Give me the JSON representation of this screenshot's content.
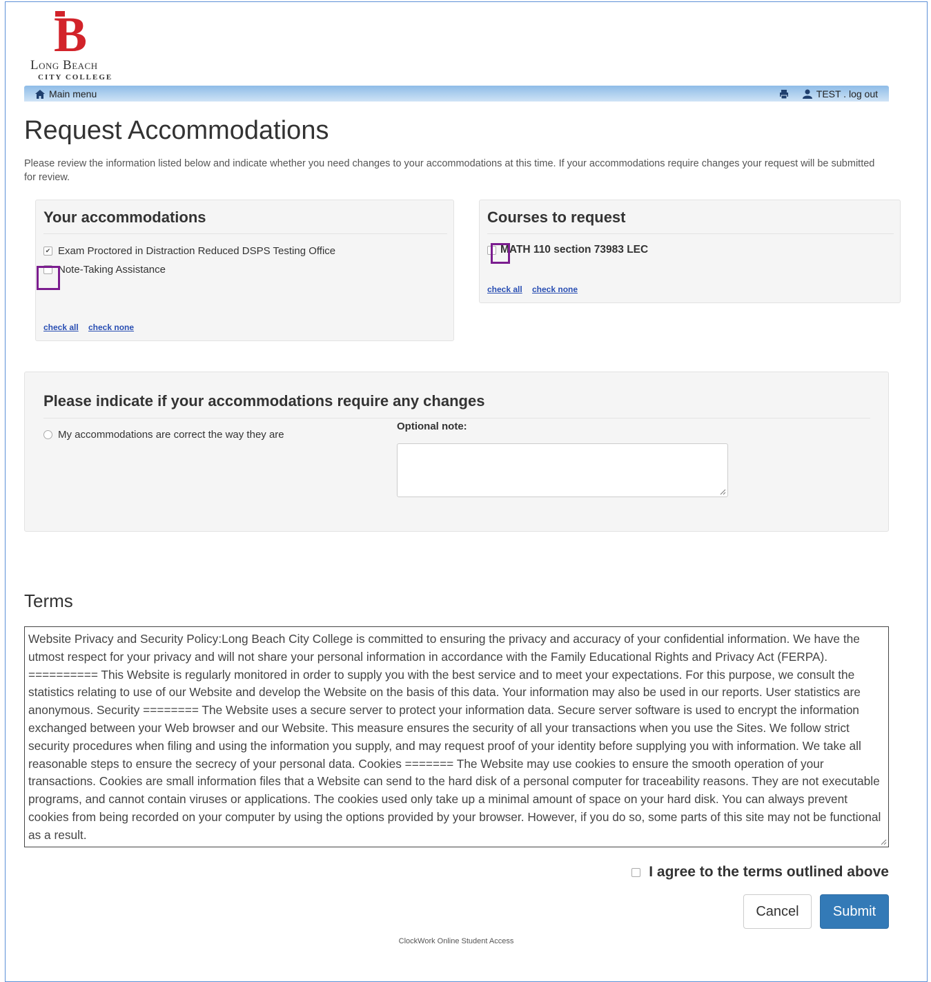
{
  "brand": {
    "name": "Long Beach",
    "subtitle": "CITY COLLEGE"
  },
  "nav": {
    "home_label": "Main menu",
    "user_label": "TEST . log out"
  },
  "page": {
    "title": "Request Accommodations",
    "intro": "Please review the information listed below and indicate whether you need changes to your accommodations at this time. If your accommodations require changes your request will be submitted for review."
  },
  "accommodations": {
    "title": "Your accommodations",
    "items": [
      {
        "label": "Exam Proctored in Distraction Reduced DSPS Testing Office",
        "checked": true
      },
      {
        "label": "Note-Taking Assistance",
        "checked": false
      }
    ],
    "check_all": "check all",
    "check_none": "check none"
  },
  "courses": {
    "title": "Courses to request",
    "items": [
      {
        "label": "MATH 110 section 73983 LEC",
        "checked": false
      }
    ],
    "check_all": "check all",
    "check_none": "check none"
  },
  "changes": {
    "title": "Please indicate if your accommodations require any changes",
    "option_label": "My accommodations are correct the way they are",
    "note_label": "Optional note:",
    "note_value": ""
  },
  "terms": {
    "title": "Terms",
    "text": "Website Privacy and Security Policy:Long Beach City College is committed to ensuring the privacy and accuracy of your confidential information. We have the utmost respect for your privacy and will not share your personal information in accordance with the Family Educational Rights and Privacy Act (FERPA). ========== This Website is regularly monitored in order to supply you with the best service and to meet your expectations. For this purpose, we consult the statistics relating to use of our Website and develop the Website on the basis of this data. Your information may also be used in our reports. User statistics are anonymous. Security ======== The Website uses a secure server to protect your information data. Secure server software is used to encrypt the information exchanged between your Web browser and our Website. This measure ensures the security of all your transactions when you use the Sites. We follow strict security procedures when filing and using the information you supply, and may request proof of your identity before supplying you with information. We take all reasonable steps to ensure the secrecy of your personal data. Cookies ======= The Website may use cookies to ensure the smooth operation of your transactions. Cookies are small information files that a Website can send to the hard disk of a personal computer for traceability reasons. They are not executable programs, and cannot contain viruses or applications. The cookies used only take up a minimal amount of space on your hard disk. You can always prevent cookies from being recorded on your computer by using the options provided by your browser. However, if you do so, some parts of this site may not be functional as a result.",
    "agree_label": "I agree to the terms outlined above"
  },
  "actions": {
    "cancel_label": "Cancel",
    "submit_label": "Submit"
  },
  "footer": {
    "text": "ClockWork Online Student Access"
  },
  "colors": {
    "accent": "#337ab7",
    "brand_red": "#d2232a",
    "highlight": "#7b1d8f",
    "link": "#2a4fb3"
  }
}
